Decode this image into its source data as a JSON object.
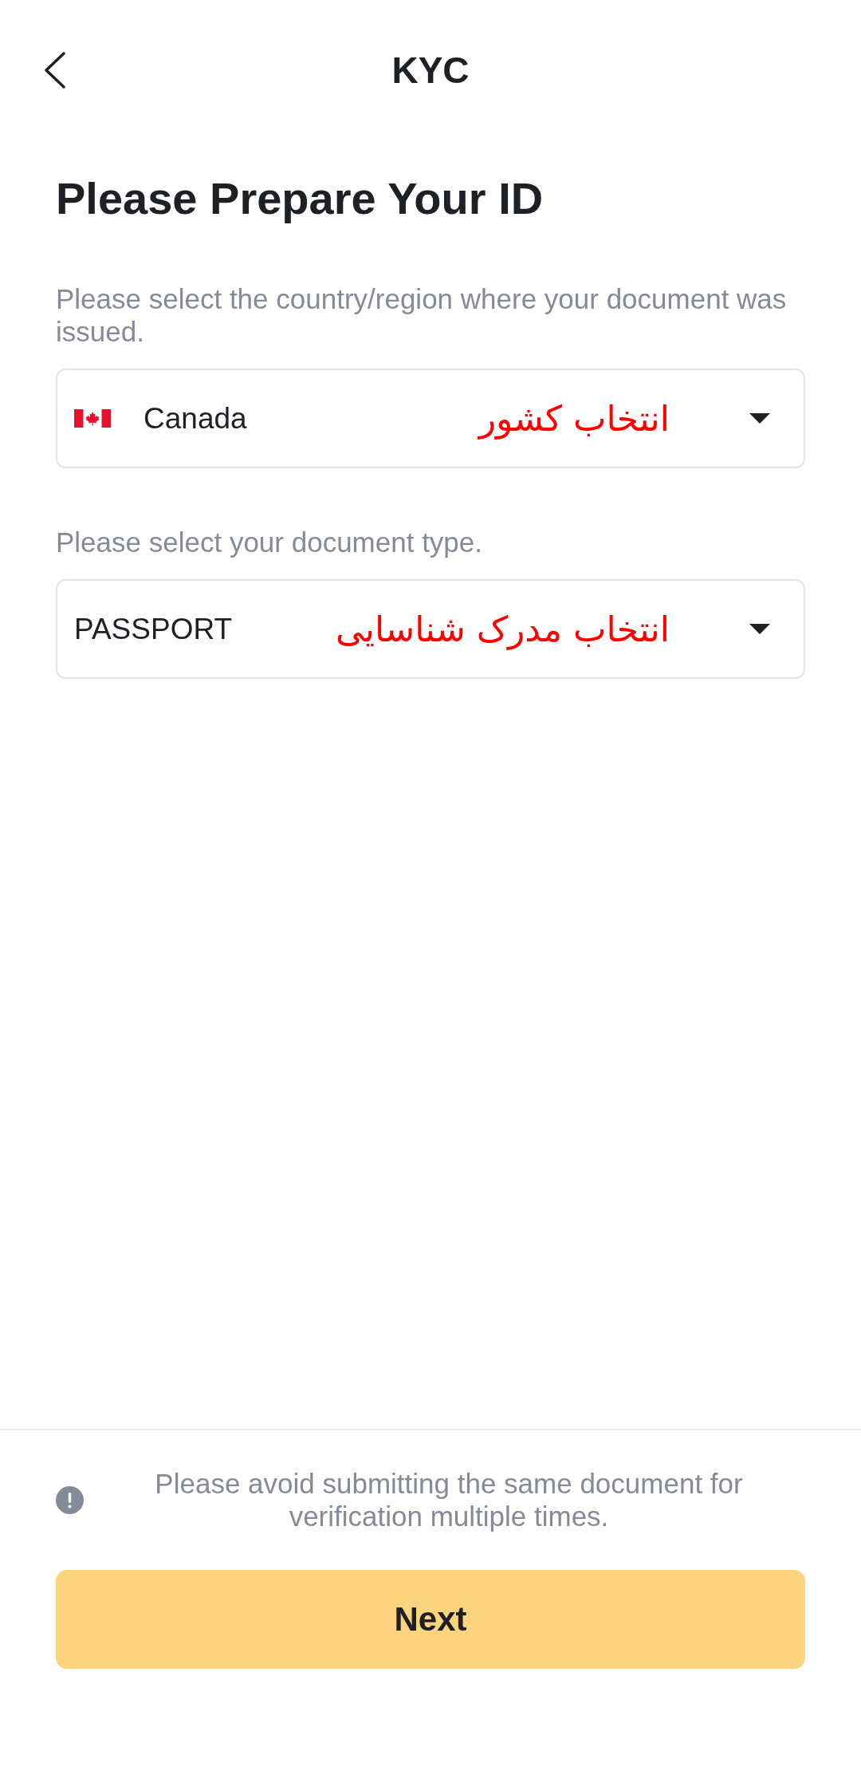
{
  "header": {
    "title": "KYC"
  },
  "heading": "Please Prepare Your ID",
  "fields": [
    {
      "kind": "country",
      "label": "Please select the country/region where your document was issued.",
      "value": "Canada",
      "annotation": "انتخاب کشور"
    },
    {
      "kind": "document",
      "label": "Please select your document type.",
      "value": "PASSPORT",
      "annotation": "انتخاب مدرک شناسایی"
    }
  ],
  "notice": "Please avoid submitting the same document for verification multiple times.",
  "next_button": {
    "label": "Next",
    "disabled": true
  }
}
